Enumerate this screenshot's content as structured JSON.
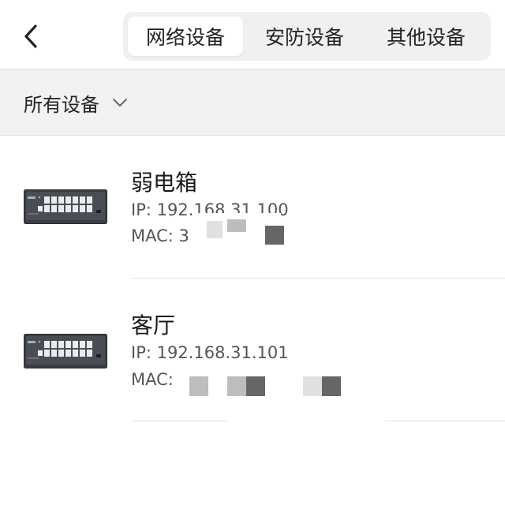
{
  "header": {
    "back_icon": "chevron-left-icon",
    "tabs": [
      {
        "label": "网络设备",
        "active": true
      },
      {
        "label": "安防设备",
        "active": false
      },
      {
        "label": "其他设备",
        "active": false
      }
    ]
  },
  "filter": {
    "label": "所有设备",
    "icon": "chevron-down-icon"
  },
  "devices": [
    {
      "name": "弱电箱",
      "ip": "IP: 192.168.31.100",
      "mac": "MAC: 3",
      "icon": "network-switch-icon"
    },
    {
      "name": "客厅",
      "ip": "IP: 192.168.31.101",
      "mac": "MAC:",
      "icon": "network-switch-icon"
    }
  ],
  "colors": {
    "tab_track": "#f0f0f0",
    "filter_bg": "#f2f2f2",
    "text_primary": "#1a1a1a",
    "text_secondary": "#555555"
  }
}
